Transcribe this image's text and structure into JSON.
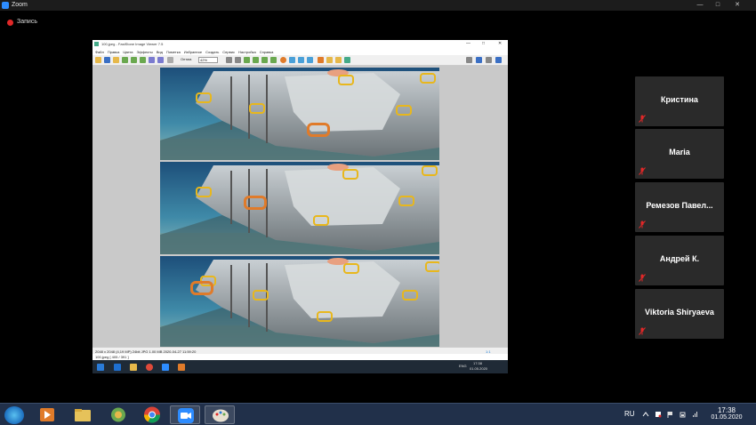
{
  "zoom": {
    "window_title": "Zoom",
    "recording_label": "Запись"
  },
  "image_viewer": {
    "title": "100.jpeg - FastStone Image Viewer 7.5",
    "menu": [
      "Файл",
      "Правка",
      "Цвета",
      "Эффекты",
      "Вид",
      "Пометка",
      "Избранное",
      "Создать",
      "Сервис",
      "Настройка",
      "Справка"
    ],
    "fit_label": "Оптим.",
    "zoom_value": "42%",
    "status_info": "2048 x 2048 (4,19 MP)  24bit  JPG    1.00 MB    2020-04-27 11:59:20",
    "status_right": "1:1",
    "path_text": "100.jpeg  [ 405 / 391 ]",
    "inner_taskbar_lang": "ENG",
    "inner_taskbar_time": "17:38",
    "inner_taskbar_date": "01.05.2020"
  },
  "participants": [
    {
      "name": "Кристина",
      "muted": true
    },
    {
      "name": "Maria",
      "muted": true
    },
    {
      "name": "Ремезов Павел...",
      "muted": true
    },
    {
      "name": "Андрей К.",
      "muted": true
    },
    {
      "name": "Viktoria Shiryaeva",
      "muted": true
    }
  ],
  "taskbar": {
    "language": "RU",
    "time": "17:38",
    "date": "01.05.2020",
    "apps": [
      "windows-media-player",
      "file-explorer",
      "picture-viewer",
      "chrome",
      "zoom",
      "paint"
    ]
  },
  "colors": {
    "accent": "#2d8cff",
    "mute": "#e02828",
    "mask_yellow": "#e8b71c",
    "mask_orange": "#e07b2a"
  }
}
